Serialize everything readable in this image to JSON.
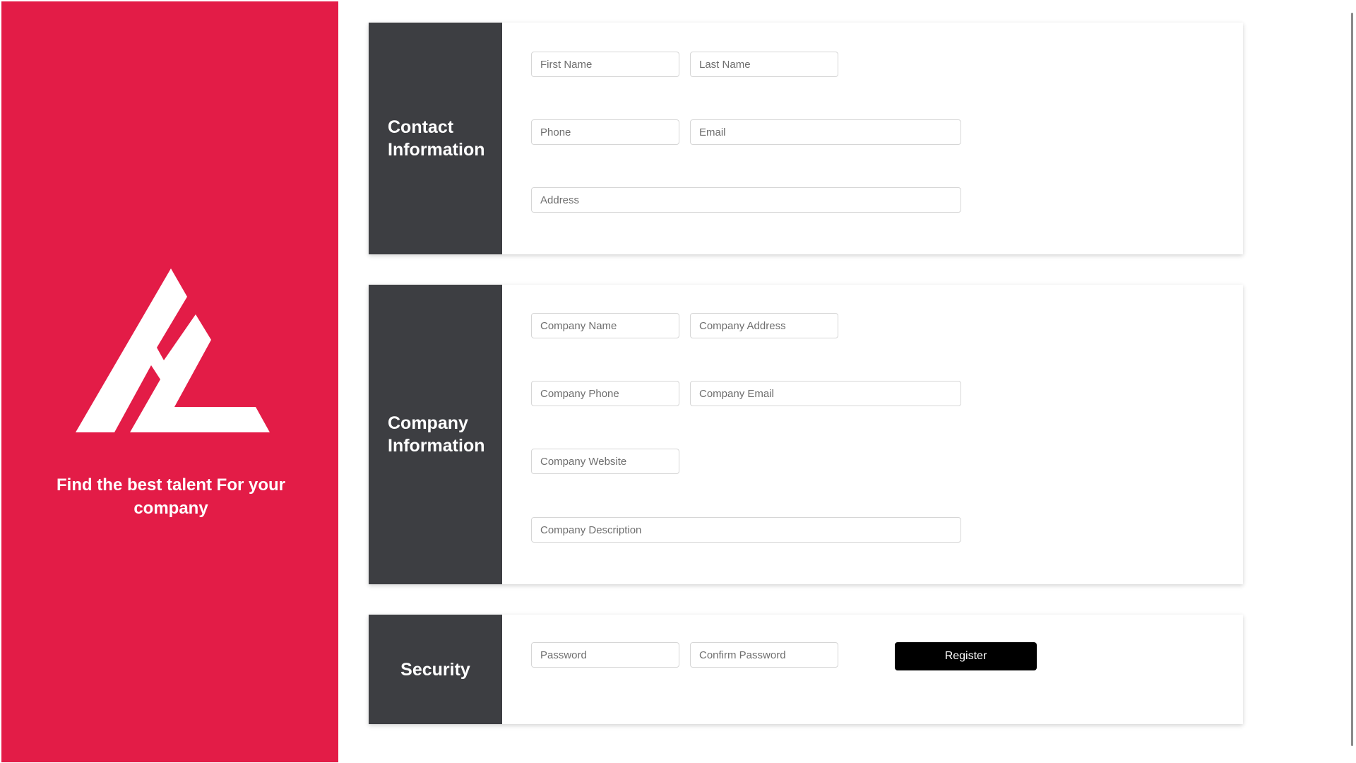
{
  "brand": {
    "tagline": "Find the best talent For your company",
    "color": "#e31c47",
    "logo_icon": "hl-logo-icon"
  },
  "contact": {
    "title": "Contact Information",
    "first_name_placeholder": "First Name",
    "last_name_placeholder": "Last Name",
    "phone_placeholder": "Phone",
    "email_placeholder": "Email",
    "address_placeholder": "Address"
  },
  "company": {
    "title": "Company Information",
    "name_placeholder": "Company Name",
    "address_placeholder": "Company Address",
    "phone_placeholder": "Company Phone",
    "email_placeholder": "Company Email",
    "website_placeholder": "Company Website",
    "description_placeholder": "Company Description"
  },
  "security": {
    "title": "Security",
    "password_placeholder": "Password",
    "confirm_password_placeholder": "Confirm Password",
    "register_label": "Register"
  },
  "colors": {
    "card_header": "#3d3e42",
    "button": "#000000"
  }
}
